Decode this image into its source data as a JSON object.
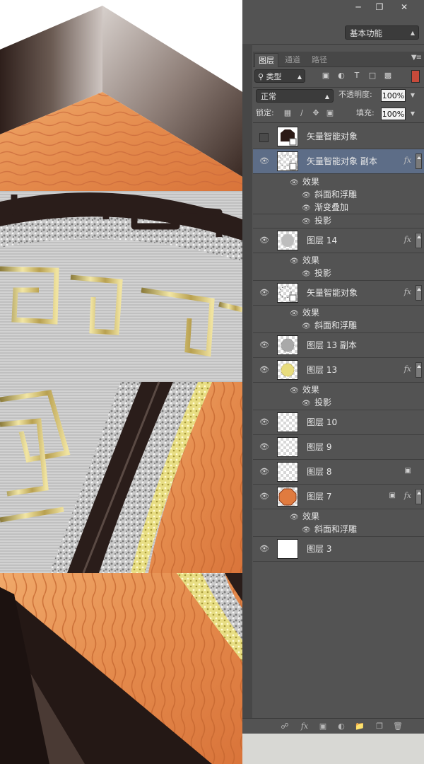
{
  "window": {
    "minimize_icon": "minimize-icon",
    "restore_icon": "restore-icon",
    "close_icon": "close-icon"
  },
  "workspace": {
    "value": "基本功能"
  },
  "tabs": [
    {
      "label": "图层",
      "active": true
    },
    {
      "label": "通道",
      "active": false
    },
    {
      "label": "路径",
      "active": false
    }
  ],
  "filter": {
    "kind_label": "类型",
    "icons": [
      "image-filter-icon",
      "adjustment-filter-icon",
      "type-filter-icon",
      "shape-filter-icon",
      "smartobject-filter-icon"
    ]
  },
  "blend": {
    "mode": "正常",
    "opacity_label": "不透明度:",
    "opacity": "100%"
  },
  "lock": {
    "label": "锁定:",
    "fill_label": "填充:",
    "fill": "100%"
  },
  "layers": [
    {
      "name": "矢量智能对象",
      "visible": false,
      "thumb": "dark-smart",
      "fx": false
    },
    {
      "name": "矢量智能对象 副本",
      "visible": true,
      "selected": true,
      "thumb": "smart-copy",
      "fx": true,
      "effects_label": "效果",
      "effects": [
        "斜面和浮雕",
        "渐变叠加",
        "投影"
      ]
    },
    {
      "name": "图层 14",
      "visible": true,
      "thumb": "gray-blob",
      "fx": true,
      "effects_label": "效果",
      "effects": [
        "投影"
      ]
    },
    {
      "name": "矢量智能对象",
      "visible": true,
      "thumb": "smart",
      "fx": true,
      "effects_label": "效果",
      "effects": [
        "斜面和浮雕"
      ]
    },
    {
      "name": "图层 13 副本",
      "visible": true,
      "thumb": "gray-dots",
      "fx": false
    },
    {
      "name": "图层 13",
      "visible": true,
      "thumb": "yellow-dots",
      "fx": true,
      "effects_label": "效果",
      "effects": [
        "投影"
      ]
    },
    {
      "name": "图层 10",
      "visible": true,
      "thumb": "transparent",
      "fx": false
    },
    {
      "name": "图层 9",
      "visible": true,
      "thumb": "transparent",
      "fx": false
    },
    {
      "name": "图层 8",
      "visible": true,
      "thumb": "transparent",
      "fx": false,
      "locked": true
    },
    {
      "name": "图层 7",
      "visible": true,
      "thumb": "orange-octagon",
      "fx": true,
      "locked": true,
      "effects_label": "效果",
      "effects": [
        "斜面和浮雕"
      ]
    },
    {
      "name": "图层 3",
      "visible": true,
      "thumb": "white",
      "fx": false
    }
  ],
  "fx_label": "fx",
  "bottom_icons": [
    "link-layers-icon",
    "add-style-icon",
    "add-mask-icon",
    "adjustment-layer-icon",
    "new-group-icon",
    "new-layer-icon",
    "delete-layer-icon"
  ],
  "colors": {
    "panel": "#535353",
    "selected": "#5d6d87",
    "wood": "#e08a4a",
    "frame_dark": "#3a2a24"
  }
}
